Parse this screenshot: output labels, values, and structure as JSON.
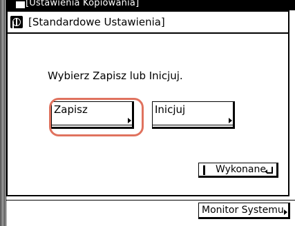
{
  "background_window": {
    "title": "[Ustawienia Kopiowania]"
  },
  "dialog": {
    "title": "[Standardowe Ustawienia]",
    "prompt": "Wybierz Zapisz lub Inicjuj.",
    "options": [
      {
        "label": "Zapisz",
        "selected": true
      },
      {
        "label": "Inicjuj",
        "selected": false
      }
    ],
    "done_label": "Wykonane"
  },
  "footer": {
    "monitor_label": "Monitor Systemu"
  },
  "colors": {
    "focus_ring": "#e0725e"
  },
  "icons": {
    "dialog": "settings-icon",
    "done": "enter-icon",
    "corner": "triangle-right-icon"
  }
}
